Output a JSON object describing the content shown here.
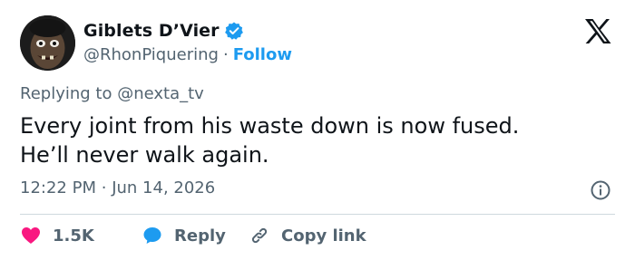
{
  "author": {
    "display_name": "Giblets D’Vier",
    "handle": "@RhonPiquering",
    "separator": "·",
    "follow_label": "Follow",
    "verified": true
  },
  "tweet": {
    "replying_prefix": "Replying to",
    "replying_to": "@nexta_tv",
    "text_line1": "Every joint from his waste down is now fused.",
    "text_line2": "He’ll never walk again.",
    "time": "12:22 PM",
    "time_separator": "·",
    "date": "Jun 14, 2026"
  },
  "actions": {
    "like_count": "1.5K",
    "reply_label": "Reply",
    "copy_link_label": "Copy link"
  },
  "colors": {
    "accent": "#1d9bf0",
    "like": "#f91880",
    "text": "#0f1419",
    "muted": "#536471",
    "divider": "#cfd9de"
  },
  "icons": {
    "brand": "x-logo-icon",
    "verified": "verified-badge-icon",
    "info": "info-icon",
    "like": "heart-icon",
    "reply": "reply-bubble-icon",
    "copy": "link-icon"
  }
}
